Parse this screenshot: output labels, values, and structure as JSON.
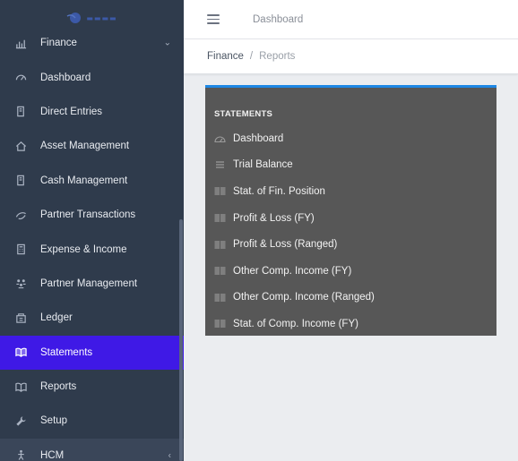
{
  "topbar": {
    "link": "Dashboard"
  },
  "breadcrumb": {
    "parent": "Finance",
    "separator": "/",
    "current": "Reports"
  },
  "sidebar": {
    "items": [
      {
        "label": "Finance",
        "icon": "chart-icon",
        "caret": "⌄"
      },
      {
        "label": "Dashboard",
        "icon": "gauge-icon"
      },
      {
        "label": "Direct Entries",
        "icon": "book-icon"
      },
      {
        "label": "Asset Management",
        "icon": "house-icon"
      },
      {
        "label": "Cash Management",
        "icon": "book-icon"
      },
      {
        "label": "Partner Transactions",
        "icon": "handshake-icon"
      },
      {
        "label": "Expense & Income",
        "icon": "calculator-icon"
      },
      {
        "label": "Partner Management",
        "icon": "people-icon"
      },
      {
        "label": "Ledger",
        "icon": "ledger-icon"
      },
      {
        "label": "Statements",
        "icon": "open-book-icon",
        "active": true
      },
      {
        "label": "Reports",
        "icon": "open-book-icon"
      },
      {
        "label": "Setup",
        "icon": "wrench-icon"
      },
      {
        "label": "HCM",
        "icon": "person-icon",
        "caret": "‹"
      }
    ]
  },
  "statements": {
    "title": "STATEMENTS",
    "items": [
      {
        "label": "Dashboard",
        "icon": "gauge-icon"
      },
      {
        "label": "Trial Balance",
        "icon": "list-icon"
      },
      {
        "label": "Stat. of Fin. Position",
        "icon": "book-icon"
      },
      {
        "label": "Profit & Loss (FY)",
        "icon": "book-icon"
      },
      {
        "label": "Profit & Loss (Ranged)",
        "icon": "book-icon"
      },
      {
        "label": "Other Comp. Income (FY)",
        "icon": "book-icon"
      },
      {
        "label": "Other Comp. Income (Ranged)",
        "icon": "book-icon"
      },
      {
        "label": "Stat. of Comp. Income (FY)",
        "icon": "book-icon"
      }
    ]
  },
  "colors": {
    "sidebar": "#2f3b4c",
    "active": "#3f19e6",
    "card": "#575757",
    "card_accent": "#1e88e5"
  }
}
